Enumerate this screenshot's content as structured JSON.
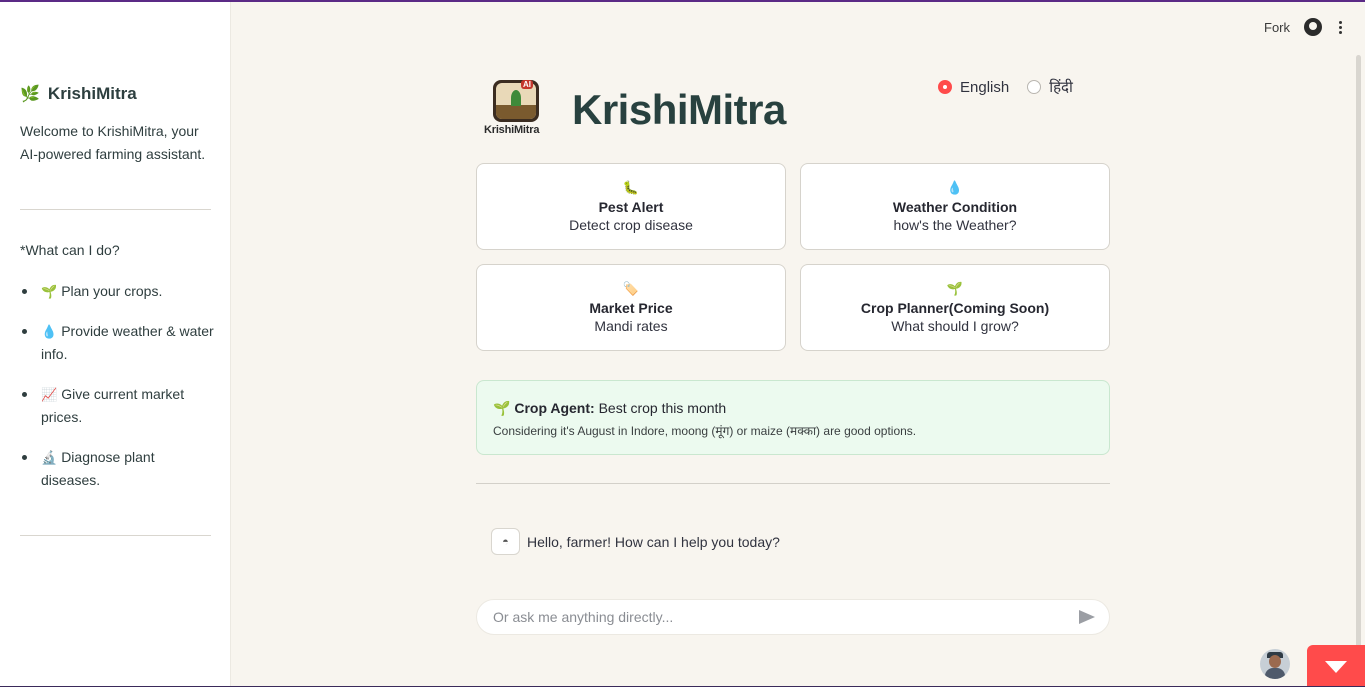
{
  "sidebar": {
    "title": "KrishiMitra",
    "title_icon": "leaf-icon",
    "welcome": "Welcome to KrishiMitra, your AI-powered farming assistant.",
    "what_label": "*What can I do?",
    "items": [
      {
        "emoji": "🌱",
        "text": "Plan your crops."
      },
      {
        "emoji": "💧",
        "text": "Provide weather & water info."
      },
      {
        "emoji": "📈",
        "text": "Give current market prices."
      },
      {
        "emoji": "🔬",
        "text": "Diagnose plant diseases."
      }
    ]
  },
  "toolbar": {
    "fork_label": "Fork",
    "github_icon": "github-icon",
    "menu_icon": "kebab-menu-icon"
  },
  "header": {
    "logo_badge": "AI",
    "logo_word": "KrishiMitra",
    "brand": "KrishiMitra"
  },
  "language": {
    "options": [
      "English",
      "हिंदी"
    ],
    "selected": "English",
    "accent": "#ff4b4b"
  },
  "cards": [
    {
      "icon": "🐛",
      "title": "Pest Alert",
      "subtitle": "Detect crop disease"
    },
    {
      "icon": "💧",
      "title": "Weather Condition",
      "subtitle": "how's the Weather?"
    },
    {
      "icon": "🏷️",
      "title": "Market Price",
      "subtitle": "Mandi rates"
    },
    {
      "icon": "🌱",
      "title": "Crop Planner(Coming Soon)",
      "subtitle": "What should I grow?"
    }
  ],
  "agent": {
    "icon": "🌱",
    "label": "Crop Agent:",
    "headline": "Best crop this month",
    "body": "Considering it's August in Indore, moong (मूंग) or maize (मक्का) are good options."
  },
  "chat": {
    "bot_icon": "robot-icon",
    "message": "Hello, farmer! How can I help you today?",
    "input_placeholder": "Or ask me anything directly...",
    "send_icon": "send-icon"
  },
  "colors": {
    "background": "#f8f5ef",
    "agent_bg": "#ecfaef",
    "brand_text": "#28413f"
  }
}
